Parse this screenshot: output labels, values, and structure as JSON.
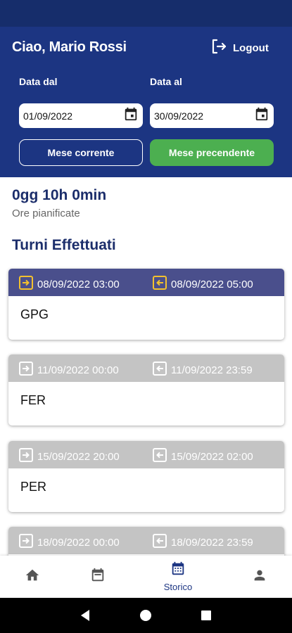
{
  "header": {
    "greeting": "Ciao, Mario Rossi",
    "logout_label": "Logout",
    "date_from_label": "Data dal",
    "date_to_label": "Data al",
    "date_from_value": "01/09/2022",
    "date_to_value": "30/09/2022",
    "current_month_label": "Mese corrente",
    "previous_month_label": "Mese precendente"
  },
  "summary": {
    "hours": "0gg 10h 0min",
    "hours_label": "Ore pianificate"
  },
  "shifts_title": "Turni Effettuati",
  "shifts": [
    {
      "start": "08/09/2022  03:00",
      "end": "08/09/2022  05:00",
      "code": "GPG",
      "active": true
    },
    {
      "start": "11/09/2022  00:00",
      "end": "11/09/2022  23:59",
      "code": "FER",
      "active": false
    },
    {
      "start": "15/09/2022  20:00",
      "end": "15/09/2022  02:00",
      "code": "PER",
      "active": false
    },
    {
      "start": "18/09/2022  00:00",
      "end": "18/09/2022  23:59",
      "code": "",
      "active": false
    }
  ],
  "nav": {
    "home_icon": "home-icon",
    "calendar_icon": "calendar-icon",
    "history_label": "Storico",
    "profile_icon": "person-icon"
  },
  "colors": {
    "primary": "#1c3582",
    "active_card_header": "#4a4f8c",
    "inactive_card_header": "#c4c4c4",
    "green": "#4caf50"
  }
}
